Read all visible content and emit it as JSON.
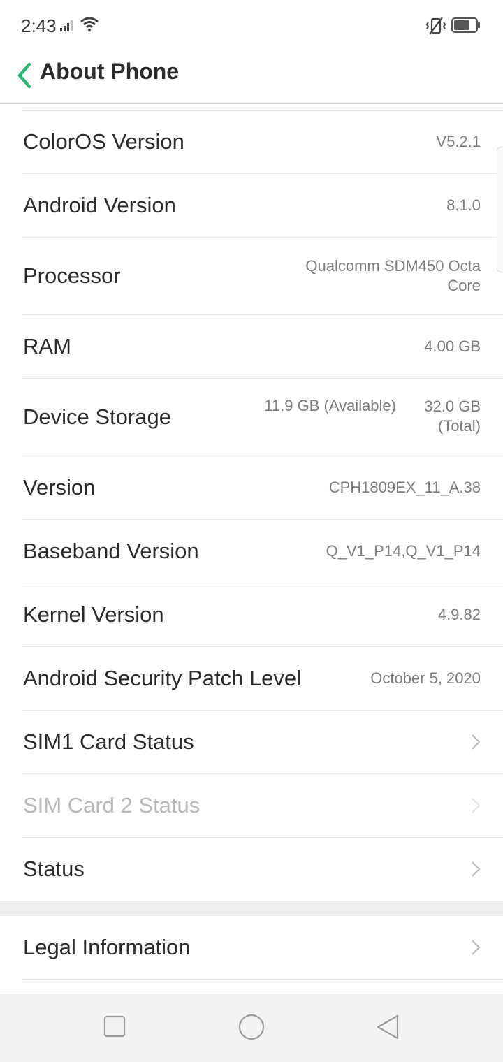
{
  "status_bar": {
    "time": "2:43",
    "icons": [
      "signal-icon",
      "wifi-icon",
      "vibrate-mute-icon",
      "battery-icon"
    ]
  },
  "header": {
    "title": "About Phone",
    "back_icon": "chevron-left-icon",
    "accent_color": "#2bb673"
  },
  "items": [
    {
      "label": "ColorOS Version",
      "value": "V5.2.1"
    },
    {
      "label": "Android Version",
      "value": "8.1.0"
    },
    {
      "label": "Processor",
      "value": "Qualcomm SDM450 Octa Core"
    },
    {
      "label": "RAM",
      "value": "4.00 GB"
    },
    {
      "label": "Device Storage",
      "available": "11.9 GB (Available)",
      "total": "32.0 GB (Total)"
    },
    {
      "label": "Version",
      "value": "CPH1809EX_11_A.38"
    },
    {
      "label": "Baseband Version",
      "value": "Q_V1_P14,Q_V1_P14"
    },
    {
      "label": "Kernel Version",
      "value": "4.9.82"
    },
    {
      "label": "Android Security Patch Level",
      "value": "October 5, 2020"
    },
    {
      "label": "SIM1 Card Status"
    },
    {
      "label": "SIM Card 2 Status",
      "disabled": true
    },
    {
      "label": "Status"
    }
  ],
  "legal": {
    "label": "Legal Information"
  },
  "nav_bar": {
    "buttons": [
      "recents-square-icon",
      "home-circle-icon",
      "back-triangle-icon"
    ]
  }
}
